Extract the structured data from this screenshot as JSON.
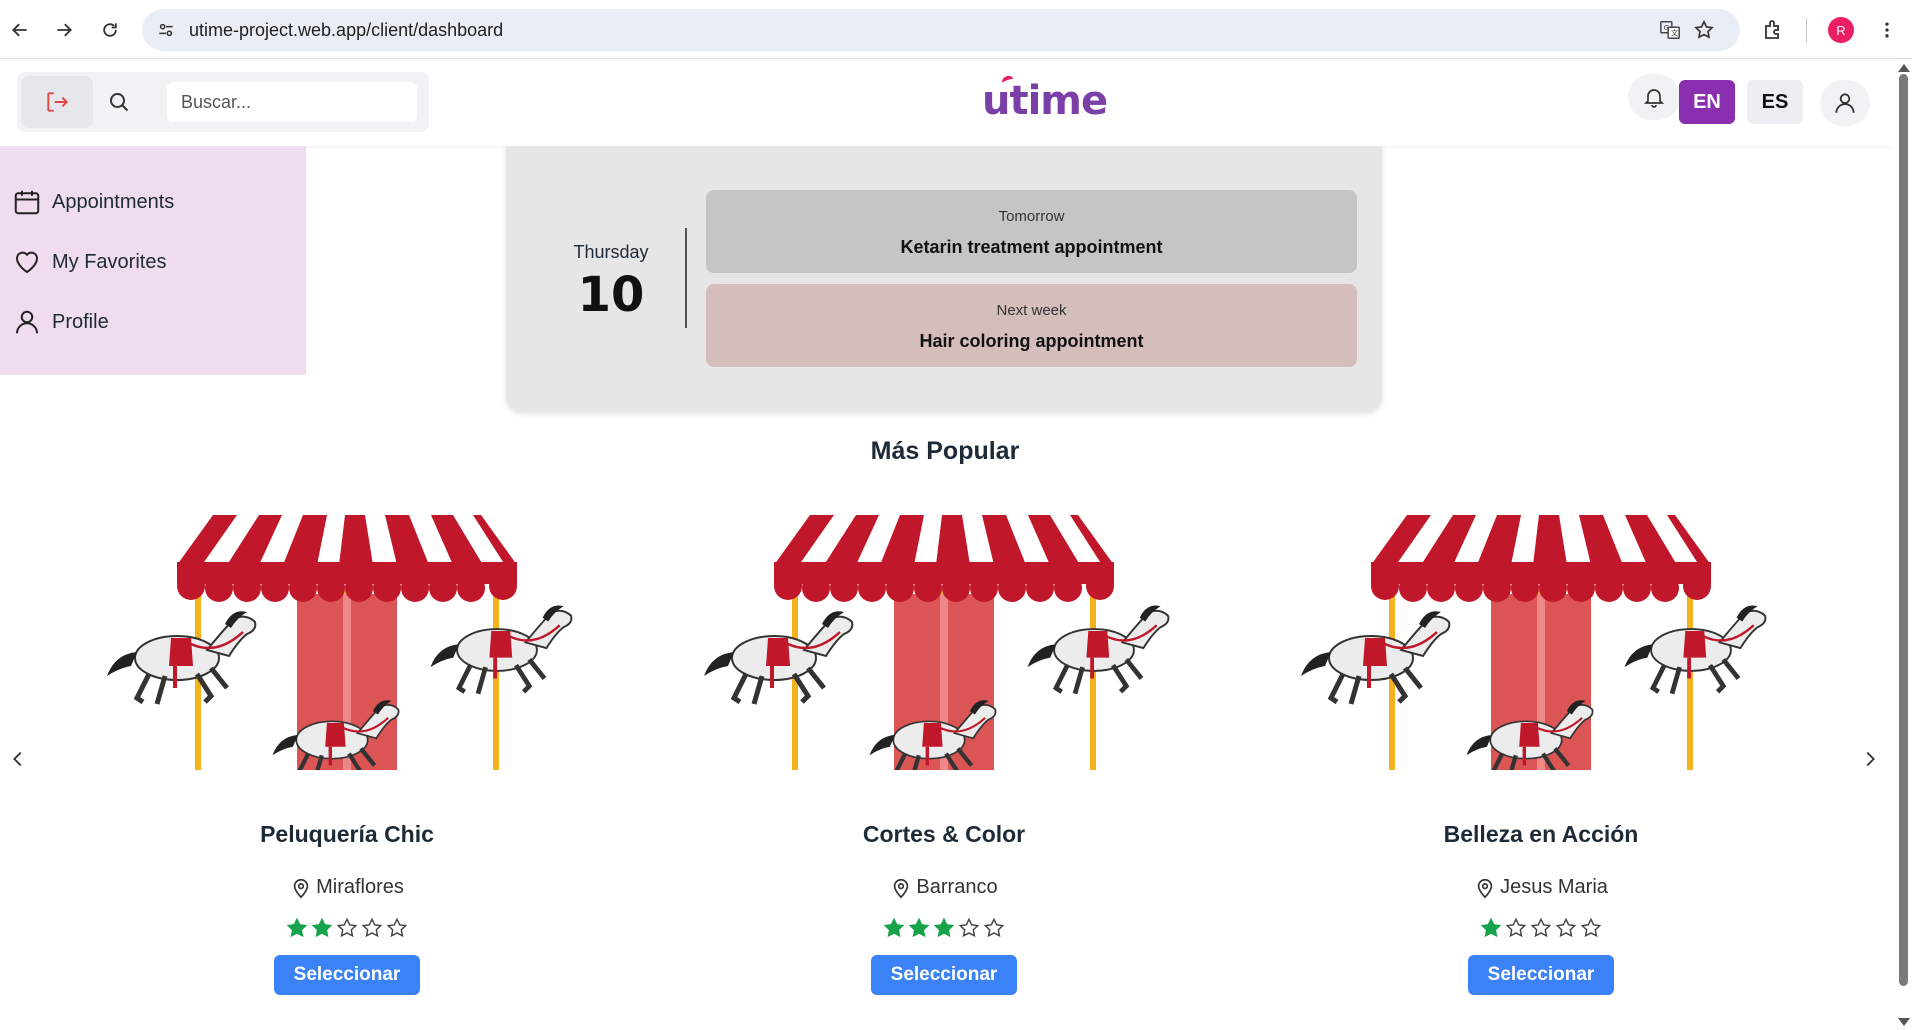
{
  "browser": {
    "url": "utime-project.web.app/client/dashboard",
    "profile_initial": "R"
  },
  "header": {
    "search_placeholder": "Buscar...",
    "logo_text": "utime",
    "lang_en": "EN",
    "lang_es": "ES",
    "colors": {
      "brand": "#7b3fa8",
      "lang_active": "#8a2fb0"
    }
  },
  "sidebar": {
    "items": [
      {
        "label": "Appointments",
        "icon": "calendar-icon"
      },
      {
        "label": "My Favorites",
        "icon": "heart-icon"
      },
      {
        "label": "Profile",
        "icon": "user-icon"
      }
    ]
  },
  "upcoming": {
    "day_name": "Thursday",
    "day_number": "10",
    "appointments": [
      {
        "when": "Tomorrow",
        "title": "Ketarin treatment appointment"
      },
      {
        "when": "Next week",
        "title": "Hair coloring appointment"
      }
    ]
  },
  "popular": {
    "title": "Más Popular",
    "select_label": "Seleccionar",
    "salons": [
      {
        "name": "Peluquería Chic",
        "location": "Miraflores",
        "rating": 2
      },
      {
        "name": "Cortes & Color",
        "location": "Barranco",
        "rating": 3
      },
      {
        "name": "Belleza en Acción",
        "location": "Jesus Maria",
        "rating": 1
      }
    ],
    "star_color": "#16a34a"
  }
}
